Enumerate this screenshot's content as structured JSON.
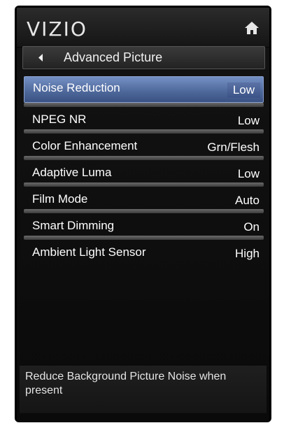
{
  "header": {
    "brand": "VIZIO",
    "home_icon": "home-icon"
  },
  "breadcrumb": {
    "back_icon": "back-arrow-icon",
    "title": "Advanced Picture"
  },
  "menu": {
    "items": [
      {
        "label": "Noise Reduction",
        "value": "Low",
        "selected": true
      },
      {
        "label": "NPEG NR",
        "value": "Low"
      },
      {
        "label": "Color Enhancement",
        "value": "Grn/Flesh"
      },
      {
        "label": "Adaptive Luma",
        "value": "Low"
      },
      {
        "label": "Film Mode",
        "value": "Auto"
      },
      {
        "label": "Smart Dimming",
        "value": "On"
      },
      {
        "label": "Ambient Light Sensor",
        "value": "High"
      }
    ]
  },
  "help": {
    "text": "Reduce Background Picture Noise when present"
  },
  "colors": {
    "selected_bg": "#5a72a6",
    "panel_bg": "#121212",
    "separator": "#5a5a5a"
  }
}
